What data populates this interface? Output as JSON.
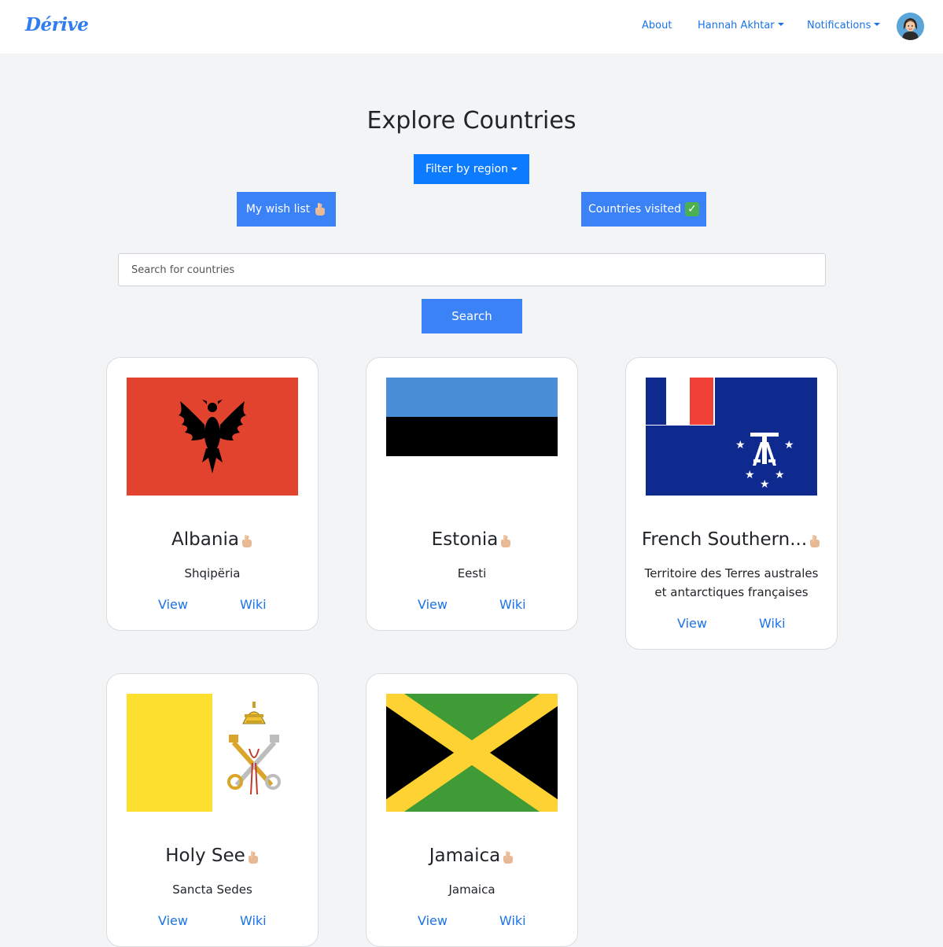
{
  "navbar": {
    "brand": "Dérive",
    "about": "About",
    "user": "Hannah Akhtar",
    "notifications": "Notifications"
  },
  "main": {
    "title": "Explore Countries",
    "filter_label": "Filter by region",
    "wishlist_label": "My wish list",
    "visited_label": "Countries visited",
    "search_placeholder": "Search for countries",
    "search_button": "Search"
  },
  "cards": [
    {
      "name": "Albania",
      "native": "Shqipëria",
      "view": "View",
      "wiki": "Wiki",
      "flag": "albania-flag"
    },
    {
      "name": "Estonia",
      "native": "Eesti",
      "view": "View",
      "wiki": "Wiki",
      "flag": "estonia-flag"
    },
    {
      "name": "French Southern...",
      "native": "Territoire des Terres australes et antarctiques françaises",
      "view": "View",
      "wiki": "Wiki",
      "flag": "french-southern-territories-flag"
    },
    {
      "name": "Holy See",
      "native": "Sancta Sedes",
      "view": "View",
      "wiki": "Wiki",
      "flag": "holy-see-flag"
    },
    {
      "name": "Jamaica",
      "native": "Jamaica",
      "view": "View",
      "wiki": "Wiki",
      "flag": "jamaica-flag"
    }
  ],
  "colors": {
    "primary": "#0d7bff",
    "secondary_button": "#3b82f6",
    "link": "#1a73e8",
    "background": "#f3f4f6"
  }
}
